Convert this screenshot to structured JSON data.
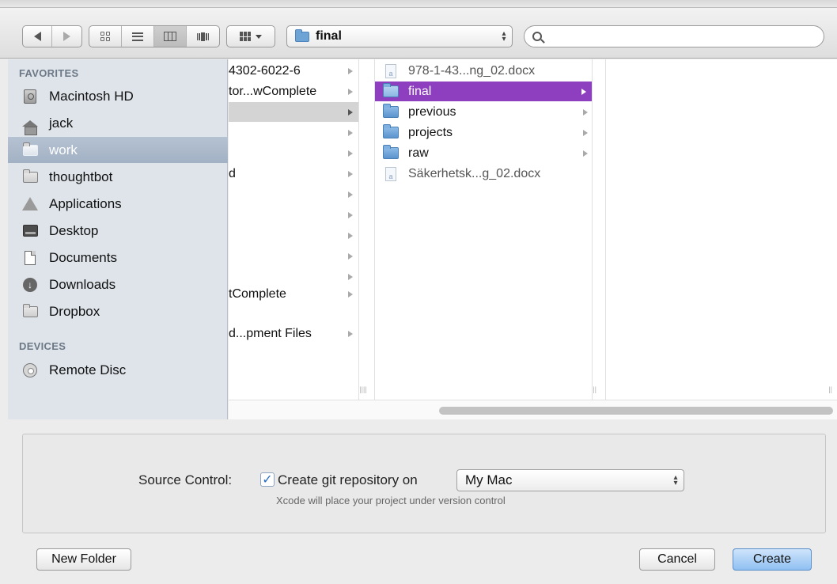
{
  "toolbar": {
    "path_label": "final",
    "search_placeholder": ""
  },
  "sidebar": {
    "favorites_header": "FAVORITES",
    "favorites": [
      {
        "label": "Macintosh HD",
        "icon": "hard-drive-icon"
      },
      {
        "label": "jack",
        "icon": "home-icon"
      },
      {
        "label": "work",
        "icon": "folder-icon",
        "selected": true
      },
      {
        "label": "thoughtbot",
        "icon": "folder-icon"
      },
      {
        "label": "Applications",
        "icon": "applications-icon"
      },
      {
        "label": "Desktop",
        "icon": "desktop-icon"
      },
      {
        "label": "Documents",
        "icon": "documents-icon"
      },
      {
        "label": "Downloads",
        "icon": "downloads-icon"
      },
      {
        "label": "Dropbox",
        "icon": "folder-icon"
      }
    ],
    "devices_header": "DEVICES",
    "devices": [
      {
        "label": "Remote Disc",
        "icon": "disc-icon"
      }
    ]
  },
  "browser": {
    "column1": [
      {
        "label": "4302-6022-6",
        "has_children": true
      },
      {
        "label": "tor...wComplete",
        "has_children": true
      },
      {
        "label": "",
        "has_children": true,
        "selected": true
      },
      {
        "label": "",
        "has_children": true
      },
      {
        "label": "",
        "has_children": true
      },
      {
        "label": "d",
        "has_children": true
      },
      {
        "label": "",
        "has_children": true
      },
      {
        "label": "",
        "has_children": true
      },
      {
        "label": "",
        "has_children": true
      },
      {
        "label": "",
        "has_children": true
      },
      {
        "label": "",
        "has_children": true
      },
      {
        "label": "tComplete",
        "has_children": true
      },
      {
        "label": "",
        "has_children": false
      },
      {
        "label": "d...pment Files",
        "has_children": true
      }
    ],
    "column2": [
      {
        "label": "978-1-43...ng_02.docx",
        "type": "file"
      },
      {
        "label": "final",
        "type": "folder",
        "selected": true
      },
      {
        "label": "previous",
        "type": "folder"
      },
      {
        "label": "projects",
        "type": "folder"
      },
      {
        "label": "raw",
        "type": "folder"
      },
      {
        "label": "Säkerhetsk...g_02.docx",
        "type": "file"
      }
    ]
  },
  "accessory": {
    "source_control_label": "Source Control:",
    "checkbox_label": "Create git repository on",
    "checkbox_checked": true,
    "location_value": "My Mac",
    "hint": "Xcode will place your project under version control"
  },
  "buttons": {
    "new_folder": "New Folder",
    "cancel": "Cancel",
    "create": "Create"
  }
}
